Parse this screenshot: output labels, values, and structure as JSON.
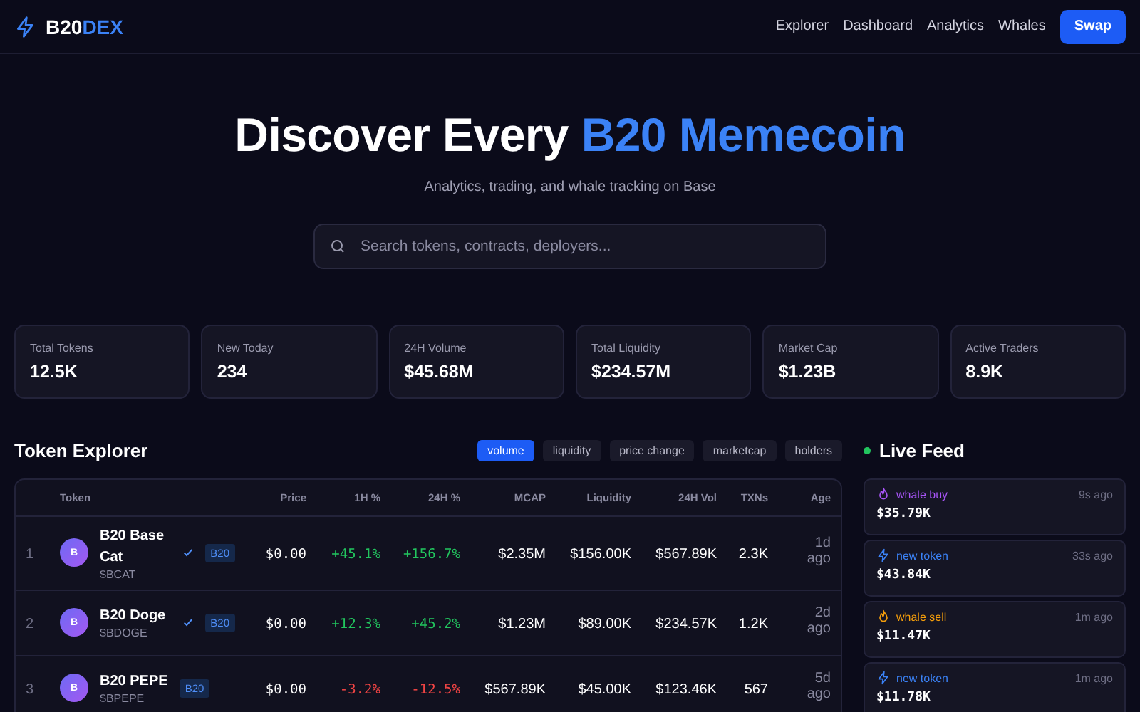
{
  "nav": {
    "logo_main": "B20",
    "logo_accent": "DEX",
    "links": [
      "Explorer",
      "Dashboard",
      "Analytics",
      "Whales"
    ],
    "action": "Swap"
  },
  "hero": {
    "title_main": "Discover Every",
    "title_accent": "B20 Memecoin",
    "subtitle": "Analytics, trading, and whale tracking on Base",
    "search": {
      "placeholder": "Search tokens, contracts, deployers..."
    }
  },
  "stats": [
    {
      "label": "Total Tokens",
      "value": "12.5K"
    },
    {
      "label": "New Today",
      "value": "234"
    },
    {
      "label": "24H Volume",
      "value": "$45.68M"
    },
    {
      "label": "Total Liquidity",
      "value": "$234.57M"
    },
    {
      "label": "Market Cap",
      "value": "$1.23B"
    },
    {
      "label": "Active Traders",
      "value": "8.9K"
    }
  ],
  "explorer": {
    "title": "Token Explorer",
    "sorts": [
      {
        "label": "volume",
        "selected": true
      },
      {
        "label": "liquidity",
        "selected": false
      },
      {
        "label": "price change",
        "selected": false
      },
      {
        "label": "marketcap",
        "selected": false
      },
      {
        "label": "holders",
        "selected": false
      }
    ],
    "columns": [
      "Token",
      "Price",
      "1H %",
      "24H %",
      "MCAP",
      "Liquidity",
      "24H Vol",
      "TXNs",
      "Age"
    ],
    "rows": [
      {
        "rank": "1",
        "avatar": "B",
        "name": "B20 Base Cat",
        "symbol": "$BCAT",
        "verified": true,
        "badge": "B20",
        "price": "$0.00",
        "change_1h": {
          "text": "+45.1%",
          "color": "#22c55e"
        },
        "change_24h": {
          "text": "+156.7%",
          "color": "#22c55e"
        },
        "mcap": "$2.35M",
        "liquidity": "$156.00K",
        "volume": "$567.89K",
        "txns": "2.3K",
        "age": "1d ago"
      },
      {
        "rank": "2",
        "avatar": "B",
        "name": "B20 Doge",
        "symbol": "$BDOGE",
        "verified": true,
        "badge": "B20",
        "price": "$0.00",
        "change_1h": {
          "text": "+12.3%",
          "color": "#22c55e"
        },
        "change_24h": {
          "text": "+45.2%",
          "color": "#22c55e"
        },
        "mcap": "$1.23M",
        "liquidity": "$89.00K",
        "volume": "$234.57K",
        "txns": "1.2K",
        "age": "2d ago"
      },
      {
        "rank": "3",
        "avatar": "B",
        "name": "B20 PEPE",
        "symbol": "$BPEPE",
        "verified": false,
        "badge": "B20",
        "price": "$0.00",
        "change_1h": {
          "text": "-3.2%",
          "color": "#ef4444"
        },
        "change_24h": {
          "text": "-12.5%",
          "color": "#ef4444"
        },
        "mcap": "$567.89K",
        "liquidity": "$45.00K",
        "volume": "$123.46K",
        "txns": "567",
        "age": "5d ago"
      }
    ]
  },
  "feed": {
    "title": "Live Feed",
    "items": [
      {
        "kind": "flame",
        "label": "whale buy",
        "color": "#a855f7",
        "time": "9s ago",
        "amount": "$35.79K"
      },
      {
        "kind": "bolt",
        "label": "new token",
        "color": "#3b82f6",
        "time": "33s ago",
        "amount": "$43.84K"
      },
      {
        "kind": "flame",
        "label": "whale sell",
        "color": "#f59e0b",
        "time": "1m ago",
        "amount": "$11.47K"
      },
      {
        "kind": "bolt",
        "label": "new token",
        "color": "#3b82f6",
        "time": "1m ago",
        "amount": "$11.78K"
      }
    ]
  }
}
